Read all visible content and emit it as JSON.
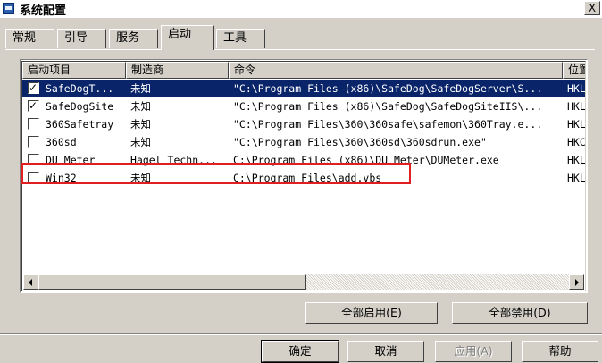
{
  "window": {
    "title": "系统配置",
    "close_label": "X"
  },
  "tabs": [
    {
      "label": "常规"
    },
    {
      "label": "引导"
    },
    {
      "label": "服务"
    },
    {
      "label": "启动"
    },
    {
      "label": "工具"
    }
  ],
  "startup_list": {
    "columns": [
      "启动项目",
      "制造商",
      "命令",
      "位置"
    ],
    "rows": [
      {
        "checked": true,
        "item": "SafeDogT...",
        "maker": "未知",
        "command": "\"C:\\Program Files (x86)\\SafeDog\\SafeDogServer\\S...",
        "location": "HKL"
      },
      {
        "checked": true,
        "item": "SafeDogSite",
        "maker": "未知",
        "command": "\"C:\\Program Files (x86)\\SafeDog\\SafeDogSiteIIS\\...",
        "location": "HKL"
      },
      {
        "checked": false,
        "item": "360Safetray",
        "maker": "未知",
        "command": "\"C:\\Program Files\\360\\360safe\\safemon\\360Tray.e...",
        "location": "HKL"
      },
      {
        "checked": false,
        "item": "360sd",
        "maker": "未知",
        "command": "\"C:\\Program Files\\360\\360sd\\360sdrun.exe\"",
        "location": "HKC"
      },
      {
        "checked": false,
        "item": "DU Meter",
        "maker": "Hagel Techn...",
        "command": "C:\\Program Files (x86)\\DU Meter\\DUMeter.exe",
        "location": "HKL"
      },
      {
        "checked": false,
        "item": "Win32",
        "maker": "未知",
        "command": "C:\\Program Files\\add.vbs",
        "location": "HKL"
      }
    ]
  },
  "buttons": {
    "enable_all": "全部启用(E)",
    "disable_all": "全部禁用(D)",
    "ok": "确定",
    "cancel": "取消",
    "apply": "应用(A)",
    "help": "帮助"
  },
  "colors": {
    "selection": "#0a246a",
    "highlight_box": "#e02020",
    "face": "#d4d0c8"
  }
}
